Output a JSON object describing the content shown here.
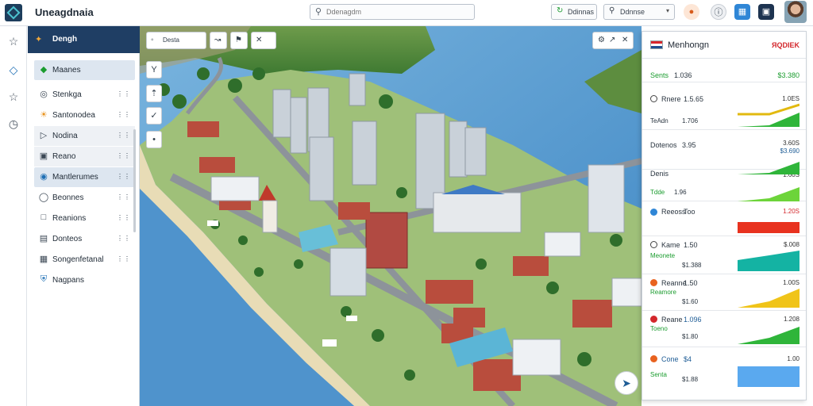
{
  "app": {
    "title": "Uneagdnaia"
  },
  "search": {
    "placeholder": "Ddenagdm"
  },
  "toolbar": {
    "button1_label": "Ddinnas",
    "select_value": "Ddnnse"
  },
  "sidebar": {
    "header": "Dengh",
    "items": [
      {
        "label": "Maanes",
        "icon": "gem-icon",
        "active": true
      },
      {
        "label": "Stenkga",
        "icon": "target-icon"
      },
      {
        "label": "Santonodea",
        "icon": "sun-icon"
      },
      {
        "label": "Nodina",
        "icon": "tag-icon"
      },
      {
        "label": "Reano",
        "icon": "document-icon"
      },
      {
        "label": "Mantlerumes",
        "icon": "globe-icon"
      },
      {
        "label": "Beonnes",
        "icon": "bulb-icon"
      },
      {
        "label": "Reanions",
        "icon": "square-icon"
      },
      {
        "label": "Donteos",
        "icon": "sheet-icon"
      },
      {
        "label": "Songenfetanal",
        "icon": "table-icon"
      },
      {
        "label": "Nagpans",
        "icon": "shield-icon"
      }
    ]
  },
  "map": {
    "toolbar": [
      {
        "label": "Desta",
        "icon": "layers-icon"
      },
      {
        "label": "",
        "icon": "route-icon"
      },
      {
        "label": "",
        "icon": "pin-icon"
      },
      {
        "label": "",
        "icon": "cross-icon"
      }
    ]
  },
  "panel": {
    "title": "Menhongn",
    "header_value": "ЯQDIEK",
    "rows": [
      {
        "label": "Sents",
        "value": "1.036",
        "right": "$3.380",
        "color": "#1b9c2f"
      },
      {
        "label": "Rnere",
        "value": "1.5.65",
        "sub": "TeAdn",
        "sub_value": "1.706",
        "right": "1.0ES"
      },
      {
        "label": "Dotenos",
        "value": "3.95",
        "right": "3.60S",
        "right_sub": "$3.690"
      },
      {
        "label": "Denis",
        "sub": "Tdde",
        "sub_value": "1.96",
        "right": "1.60S"
      },
      {
        "label": "Reeoss",
        "value": "Too",
        "right": "1.20S"
      },
      {
        "label": "Kame",
        "value": "1.50",
        "sub": "Meonete",
        "sub_value": "$1.388",
        "right": "$.008"
      },
      {
        "label": "Reanne",
        "value": "1.50",
        "sub": "Reamore",
        "sub_value": "$1.60",
        "right": "1.00S"
      },
      {
        "label": "Reane",
        "value": "1.096",
        "sub": "Toeno",
        "sub_value": "$1.80",
        "right": "1.208"
      },
      {
        "label": "Cone",
        "value": "$4",
        "sub": "Senta",
        "sub_value": "$1.88",
        "right": "1.00"
      }
    ]
  },
  "colors": {
    "sidebar_header": "#1f3e64",
    "accent_green": "#1b9c2f",
    "accent_red": "#d3272c",
    "accent_blue": "#1f5d96"
  }
}
